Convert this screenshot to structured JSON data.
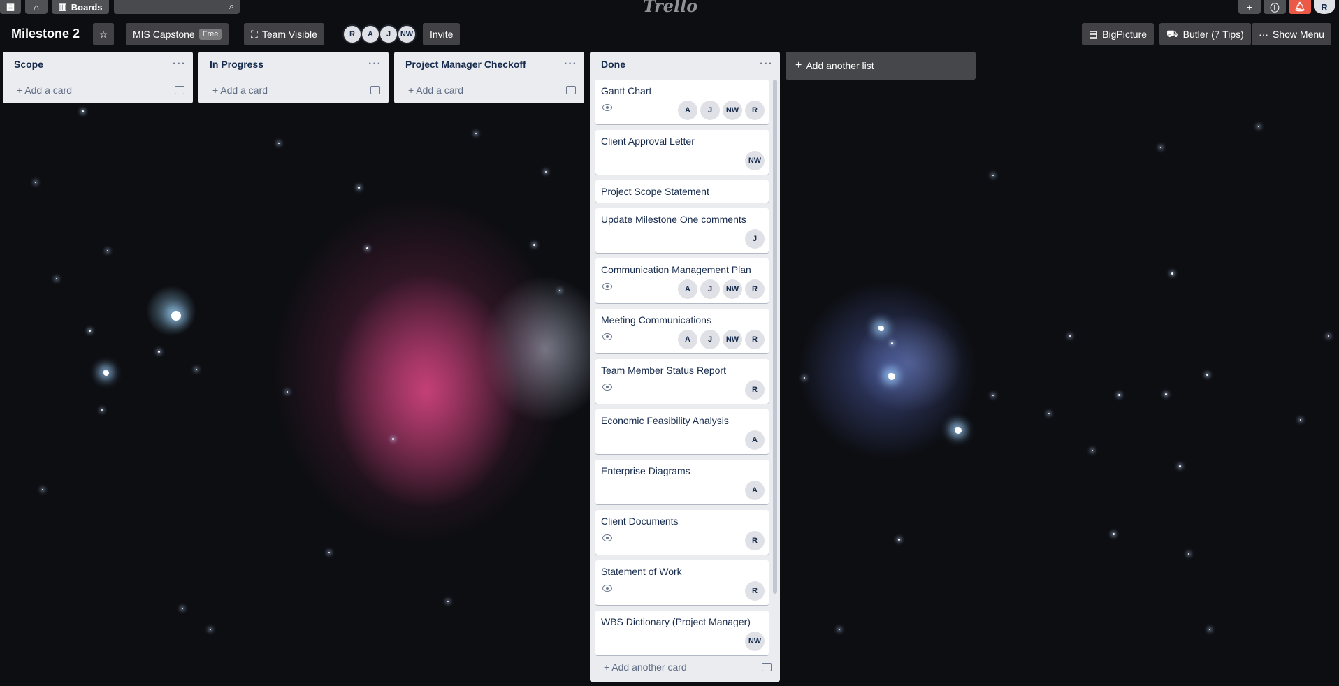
{
  "topbar": {
    "boards_label": "Boards",
    "logo": "Trello",
    "avatar": "R"
  },
  "board": {
    "title": "Milestone 2",
    "team": "MIS Capstone",
    "team_badge": "Free",
    "visibility": "Team Visible",
    "members": [
      "R",
      "A",
      "J",
      "NW"
    ],
    "invite": "Invite",
    "bigpicture": "BigPicture",
    "butler": "Butler (7 Tips)",
    "show_menu": "Show Menu"
  },
  "lists": [
    {
      "title": "Scope",
      "add_card": "Add a card"
    },
    {
      "title": "In Progress",
      "add_card": "Add a card"
    },
    {
      "title": "Project Manager Checkoff",
      "add_card": "Add a card"
    }
  ],
  "done": {
    "title": "Done",
    "add_card": "Add another card",
    "cards": [
      {
        "title": "Gantt Chart",
        "watched": true,
        "members": [
          "A",
          "J",
          "NW",
          "R"
        ]
      },
      {
        "title": "Client Approval Letter",
        "watched": false,
        "members": [
          "NW"
        ]
      },
      {
        "title": "Project Scope Statement",
        "watched": false,
        "members": []
      },
      {
        "title": "Update Milestone One comments",
        "watched": false,
        "members": [
          "J"
        ]
      },
      {
        "title": "Communication Management Plan",
        "watched": true,
        "members": [
          "A",
          "J",
          "NW",
          "R"
        ]
      },
      {
        "title": "Meeting Communications",
        "watched": true,
        "members": [
          "A",
          "J",
          "NW",
          "R"
        ]
      },
      {
        "title": "Team Member Status Report",
        "watched": true,
        "members": [
          "R"
        ]
      },
      {
        "title": "Economic Feasibility Analysis",
        "watched": false,
        "members": [
          "A"
        ]
      },
      {
        "title": "Enterprise Diagrams",
        "watched": false,
        "members": [
          "A"
        ]
      },
      {
        "title": "Client Documents",
        "watched": true,
        "members": [
          "R"
        ]
      },
      {
        "title": "Statement of Work",
        "watched": true,
        "members": [
          "R"
        ]
      },
      {
        "title": "WBS Dictionary (Project Manager)",
        "watched": false,
        "members": [
          "NW"
        ]
      }
    ]
  },
  "add_list": "Add another list",
  "colors": {
    "card_bg": "#ffffff",
    "list_bg": "#ebecf0",
    "notification": "#eb5a46"
  }
}
